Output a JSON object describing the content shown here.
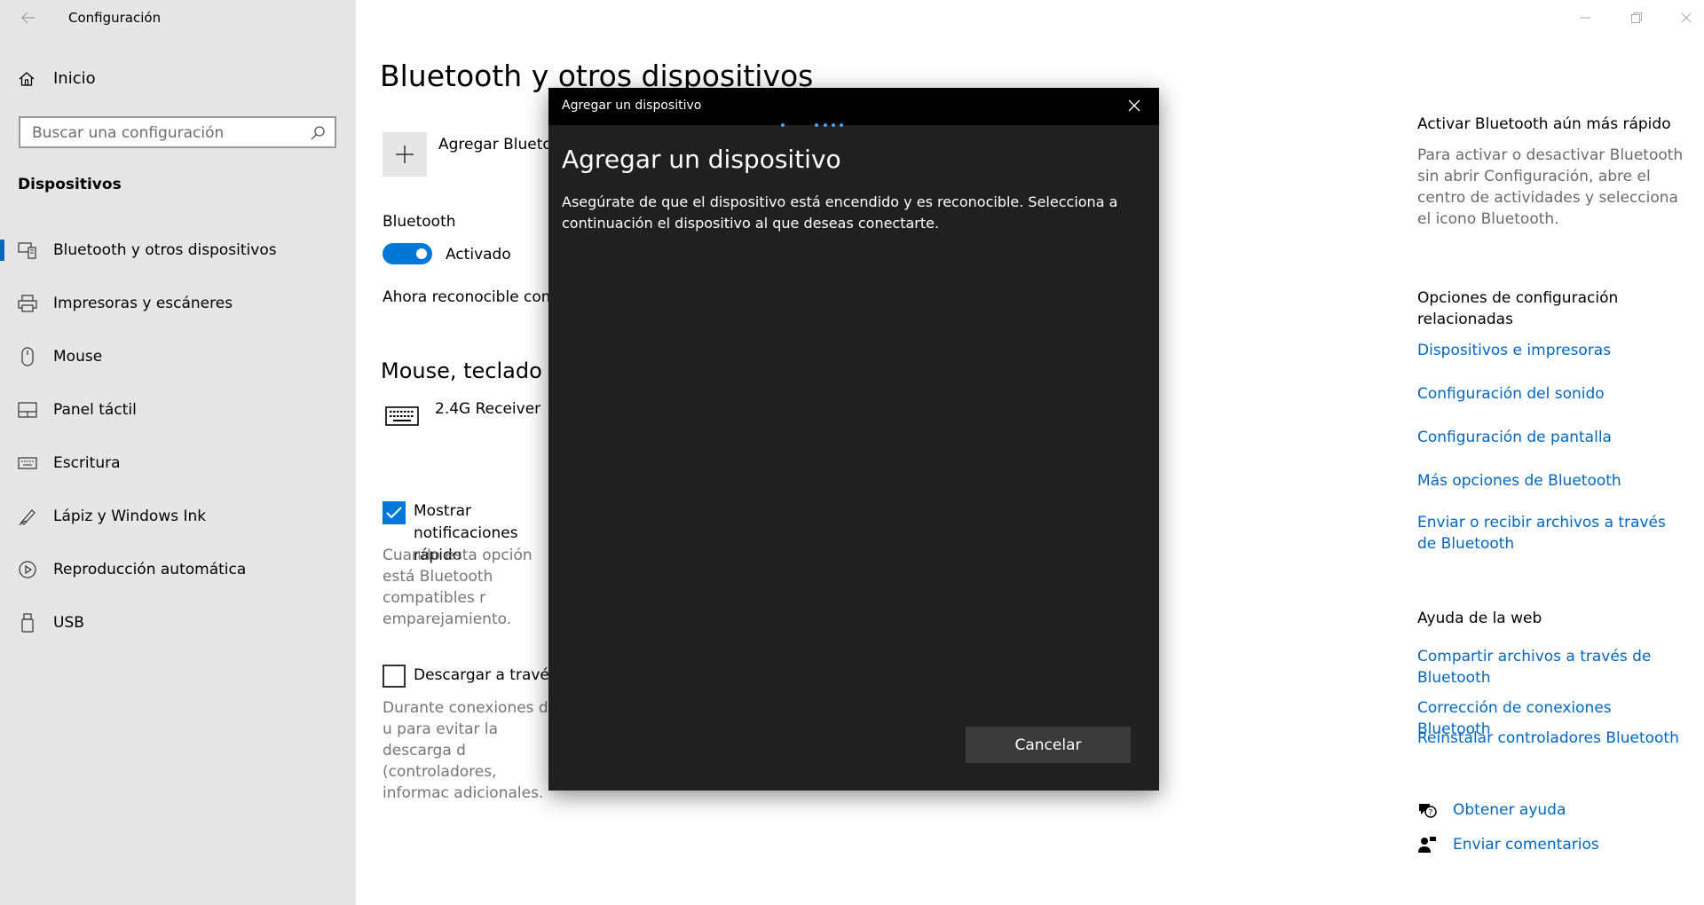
{
  "window": {
    "title": "Configuración",
    "controls": [
      "minimize-icon",
      "restore-icon",
      "close-icon"
    ]
  },
  "sidebar": {
    "home_label": "Inicio",
    "search_placeholder": "Buscar una configuración",
    "section_title": "Dispositivos",
    "items": [
      {
        "label": "Bluetooth y otros dispositivos",
        "icon": "bluetooth-devices-icon",
        "selected": true
      },
      {
        "label": "Impresoras y escáneres",
        "icon": "printer-icon",
        "selected": false
      },
      {
        "label": "Mouse",
        "icon": "mouse-icon",
        "selected": false
      },
      {
        "label": "Panel táctil",
        "icon": "touchpad-icon",
        "selected": false
      },
      {
        "label": "Escritura",
        "icon": "keyboard-icon",
        "selected": false
      },
      {
        "label": "Lápiz y Windows Ink",
        "icon": "pen-icon",
        "selected": false
      },
      {
        "label": "Reproducción automática",
        "icon": "autoplay-icon",
        "selected": false
      },
      {
        "label": "USB",
        "icon": "usb-icon",
        "selected": false
      }
    ]
  },
  "main": {
    "title": "Bluetooth y otros dispositivos",
    "add_device_label": "Agregar Bluetooth",
    "bluetooth_label": "Bluetooth",
    "bluetooth_state": "Activado",
    "discoverable_text": "Ahora reconocible como",
    "section_title": "Mouse, teclado y",
    "devices": [
      {
        "name": "2.4G Receiver",
        "icon": "keyboard-icon"
      }
    ],
    "notif_checkbox": {
      "label": "Mostrar notificaciones rápido",
      "checked": true,
      "description": "Cuando esta opción está Bluetooth compatibles r emparejamiento."
    },
    "download_checkbox": {
      "label": "Descargar a través d",
      "checked": false,
      "description": "Durante conexiones de u para evitar la descarga d (controladores, informac adicionales."
    }
  },
  "right_panel": {
    "quick_title": "Activar Bluetooth aún más rápido",
    "quick_text": "Para activar o desactivar Bluetooth sin abrir Configuración, abre el centro de actividades y selecciona el icono Bluetooth.",
    "related_title": "Opciones de configuración relacionadas",
    "related_links": [
      "Dispositivos e impresoras",
      "Configuración del sonido",
      "Configuración de pantalla",
      "Más opciones de Bluetooth",
      "Enviar o recibir archivos a través de Bluetooth"
    ],
    "web_help_title": "Ayuda de la web",
    "web_help_links": [
      "Compartir archivos a través de Bluetooth",
      "Corrección de conexiones Bluetooth",
      "Reinstalar controladores Bluetooth"
    ],
    "get_help": "Obtener ayuda",
    "feedback": "Enviar comentarios"
  },
  "dialog": {
    "titlebar": "Agregar un dispositivo",
    "heading": "Agregar un dispositivo",
    "body": "Asegúrate de que el dispositivo está encendido y es reconocible. Selecciona a continuación el dispositivo al que deseas conectarte.",
    "cancel_label": "Cancelar",
    "accent": "#4aa0ff"
  },
  "colors": {
    "accent": "#0078d7",
    "link": "#0067c0",
    "sidebar_bg": "#e6e6e6",
    "dialog_bg": "#202020"
  }
}
